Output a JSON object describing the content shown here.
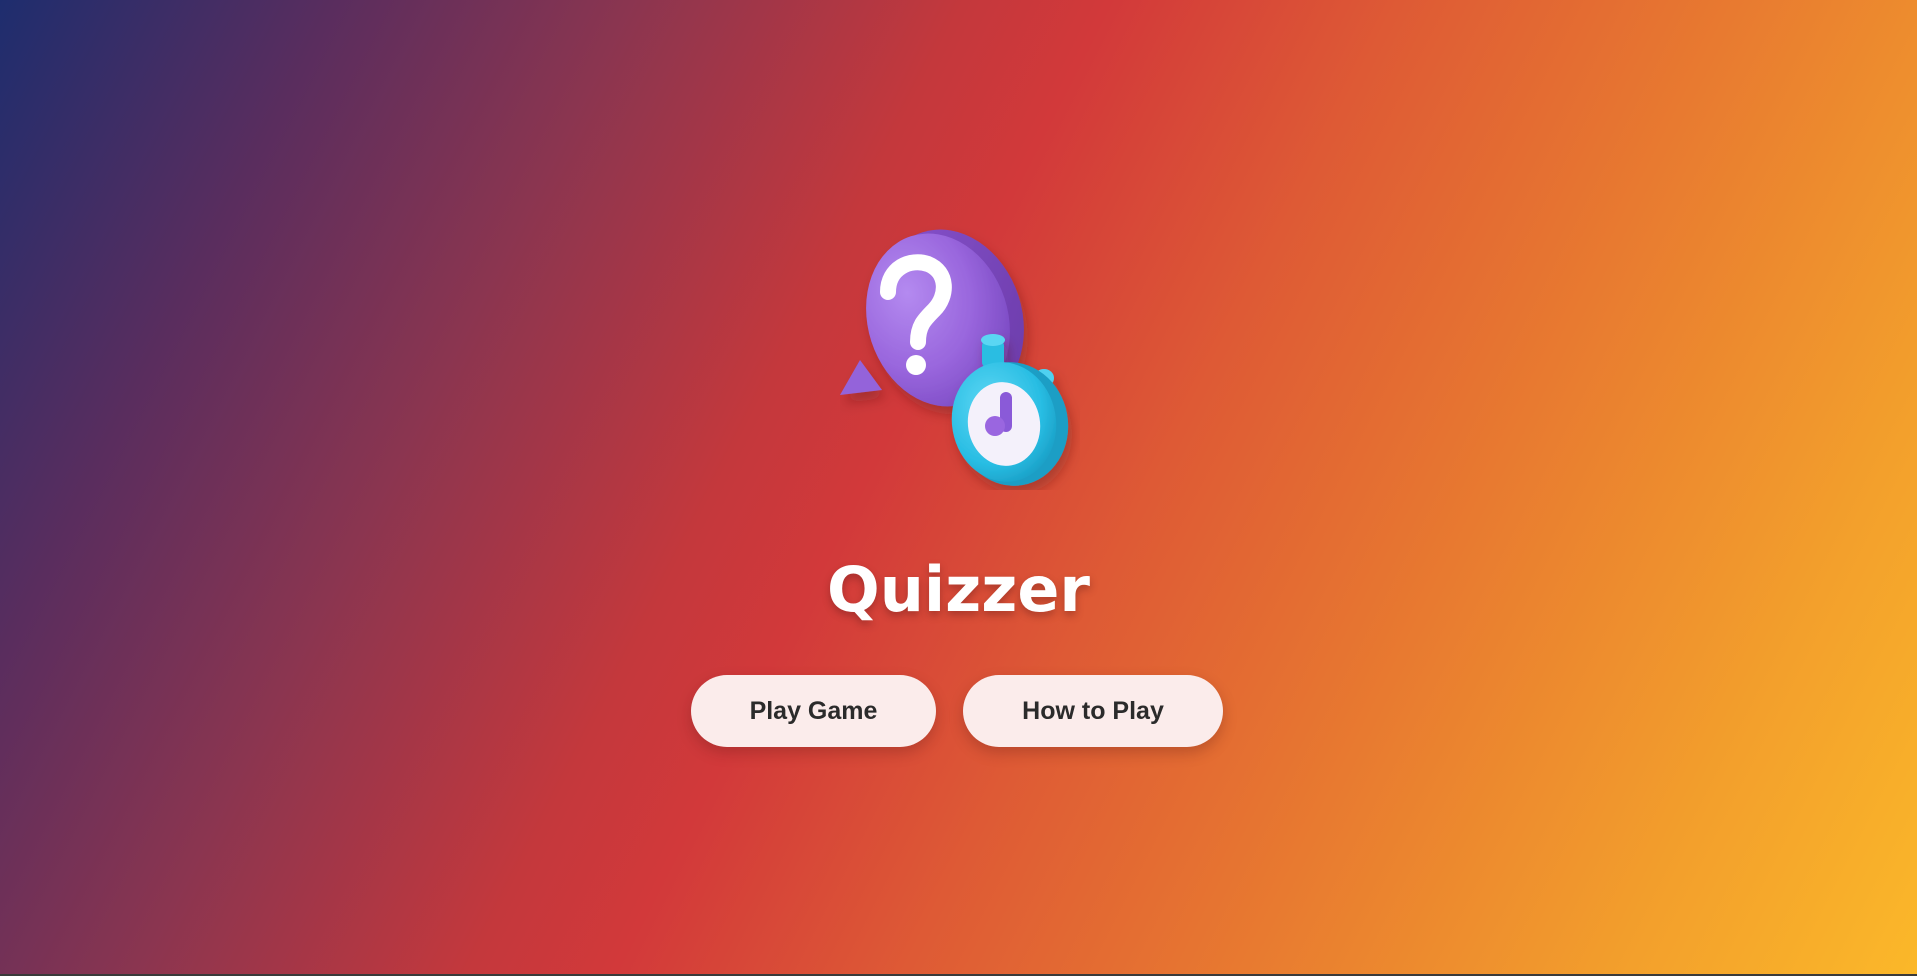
{
  "app": {
    "title": "Quizzer"
  },
  "logo": {
    "icon": "question-bubble-stopwatch-icon",
    "bubble_color": "#9b6be0",
    "stopwatch_color": "#2ec3e6"
  },
  "menu": {
    "play_label": "Play Game",
    "how_label": "How to Play"
  },
  "theme": {
    "gradient": [
      "#1e2d6e",
      "#d2393a",
      "#e87a30",
      "#fbb829"
    ],
    "button_bg": "#fbeceb",
    "button_text": "#2b2b2b",
    "title_color": "#ffffff"
  }
}
